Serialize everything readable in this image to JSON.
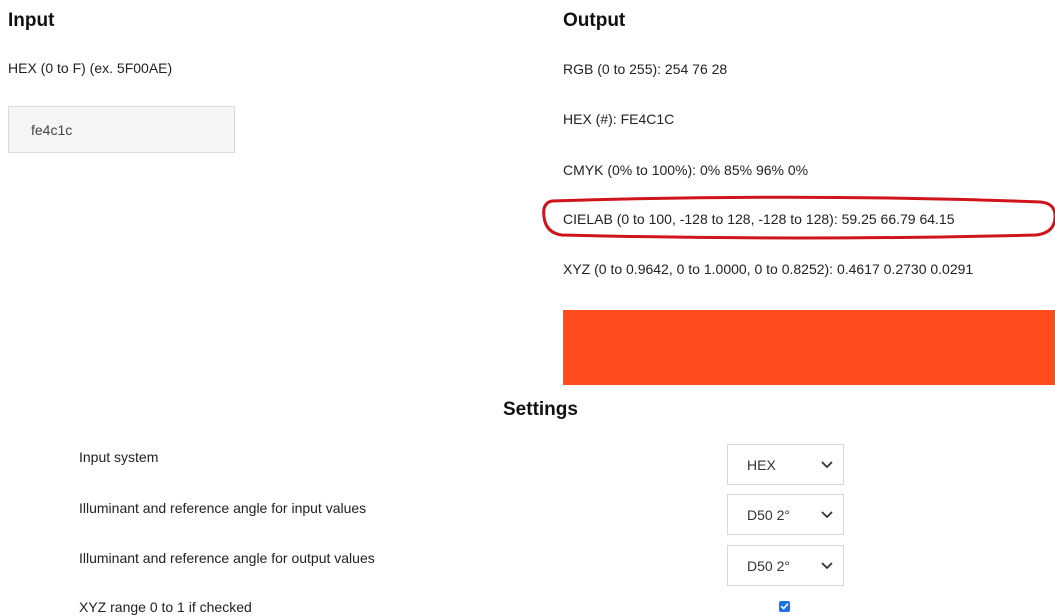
{
  "input": {
    "title": "Input",
    "hint": "HEX (0 to F) (ex. 5F00AE)",
    "value": "fe4c1c"
  },
  "output": {
    "title": "Output",
    "rgb": "RGB (0 to 255): 254 76 28",
    "hex": "HEX (#): FE4C1C",
    "cmyk": "CMYK (0% to 100%): 0% 85% 96% 0%",
    "cielab": "CIELAB (0 to 100, -128 to 128, -128 to 128): 59.25 66.79 64.15",
    "xyz": "XYZ (0 to 0.9642, 0 to 1.0000, 0 to 0.8252): 0.4617 0.2730 0.0291",
    "swatch_color": "#FE4C1C",
    "highlight_color": "#D0141B"
  },
  "settings": {
    "title": "Settings",
    "input_system_label": "Input system",
    "input_system_value": "HEX",
    "illuminant_input_label": "Illuminant and reference angle for input values",
    "illuminant_input_value": "D50 2°",
    "illuminant_output_label": "Illuminant and reference angle for output values",
    "illuminant_output_value": "D50 2°",
    "xyz_range_label": "XYZ range 0 to 1 if checked",
    "xyz_range_checked": true
  },
  "icons": {
    "dropdown": "chevron-down-icon",
    "check": "checkmark-icon"
  }
}
